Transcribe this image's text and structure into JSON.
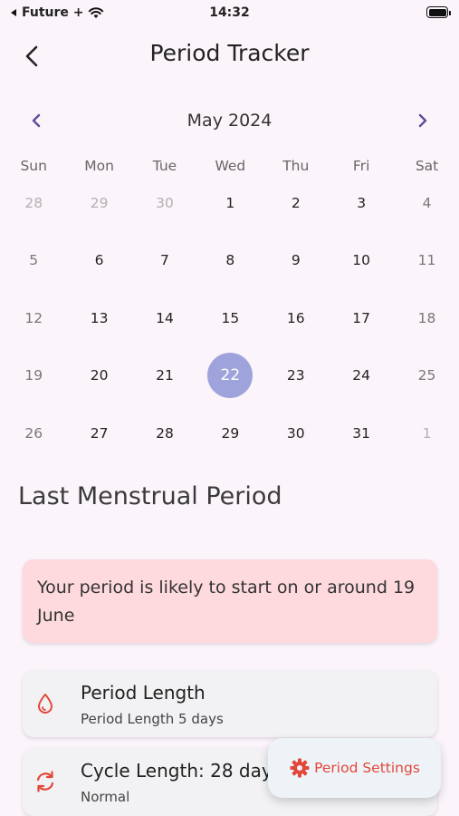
{
  "status_bar": {
    "carrier": "Future +",
    "time": "14:32"
  },
  "header": {
    "title": "Period Tracker",
    "back_icon": "chevron-left-icon"
  },
  "calendar": {
    "month_label": "May 2024",
    "weekdays": [
      "Sun",
      "Mon",
      "Tue",
      "Wed",
      "Thu",
      "Fri",
      "Sat"
    ],
    "weeks": [
      [
        "28",
        "29",
        "30",
        "1",
        "2",
        "3",
        "4"
      ],
      [
        "5",
        "6",
        "7",
        "8",
        "9",
        "10",
        "11"
      ],
      [
        "12",
        "13",
        "14",
        "15",
        "16",
        "17",
        "18"
      ],
      [
        "19",
        "20",
        "21",
        "22",
        "23",
        "24",
        "25"
      ],
      [
        "26",
        "27",
        "28",
        "29",
        "30",
        "31",
        "1"
      ]
    ],
    "selected_day": "22",
    "accent_color": "#9ea4db"
  },
  "section": {
    "title": "Last Menstrual Period"
  },
  "alert": {
    "text": "Your period is likely to start on or around 19 June",
    "background": "#fed9dd"
  },
  "cards": {
    "period": {
      "title": "Period Length",
      "subtitle": "Period Length 5 days",
      "icon": "droplet-icon"
    },
    "cycle": {
      "title": "Cycle Length: 28 days",
      "subtitle": "Normal",
      "icon": "sync-icon"
    }
  },
  "fab": {
    "label": "Period Settings",
    "icon": "gear-icon",
    "color": "#e2473a"
  }
}
